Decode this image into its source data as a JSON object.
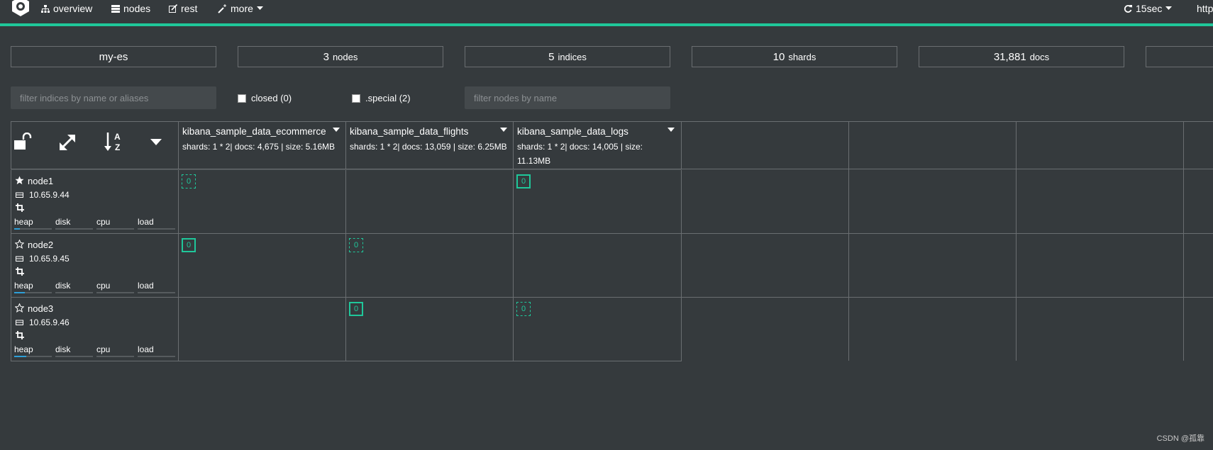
{
  "navbar": {
    "logo": "elasticsearch-head-logo-icon",
    "items": [
      {
        "label": "overview",
        "icon": "sitemap-icon"
      },
      {
        "label": "nodes",
        "icon": "server-icon"
      },
      {
        "label": "rest",
        "icon": "edit-icon"
      },
      {
        "label": "more",
        "icon": "magic-wand-icon"
      }
    ],
    "refresh": "15sec",
    "right_cut": "http"
  },
  "stats": {
    "cluster_name": "my-es",
    "nodes_count": "3",
    "nodes_label": "nodes",
    "indices_count": "5",
    "indices_label": "indices",
    "shards_count": "10",
    "shards_label": "shards",
    "docs_count": "31,881",
    "docs_label": "docs"
  },
  "filters": {
    "indices_placeholder": "filter indices by name or aliases",
    "closed_label": "closed (0)",
    "special_label": ".special (2)",
    "nodes_placeholder": "filter nodes by name"
  },
  "indices": [
    {
      "name": "kibana_sample_data_ecommerce",
      "info": "shards: 1 * 2| docs: 4,675 | size: 5.16MB"
    },
    {
      "name": "kibana_sample_data_flights",
      "info": "shards: 1 * 2| docs: 13,059 | size: 6.25MB"
    },
    {
      "name": "kibana_sample_data_logs",
      "info": "shards: 1 * 2| docs: 14,005 | size: 11.13MB"
    }
  ],
  "nodes": [
    {
      "name": "node1",
      "ip": "10.65.9.44",
      "master": true,
      "heap_fraction": 0.15
    },
    {
      "name": "node2",
      "ip": "10.65.9.45",
      "master": false,
      "heap_fraction": 0.28
    },
    {
      "name": "node3",
      "ip": "10.65.9.46",
      "master": false,
      "heap_fraction": 0.32
    }
  ],
  "metrics": [
    "heap",
    "disk",
    "cpu",
    "load"
  ],
  "shards": [
    {
      "node": 0,
      "index": 0,
      "label": "0",
      "type": "replica"
    },
    {
      "node": 0,
      "index": 2,
      "label": "0",
      "type": "primary"
    },
    {
      "node": 1,
      "index": 0,
      "label": "0",
      "type": "primary"
    },
    {
      "node": 1,
      "index": 1,
      "label": "0",
      "type": "replica"
    },
    {
      "node": 2,
      "index": 1,
      "label": "0",
      "type": "primary"
    },
    {
      "node": 2,
      "index": 2,
      "label": "0",
      "type": "replica"
    }
  ],
  "footer": "CSDN @孤靠",
  "colors": {
    "accent": "#1fc79a",
    "background": "#353a3d",
    "heap_bar": "#2e9fd8"
  }
}
